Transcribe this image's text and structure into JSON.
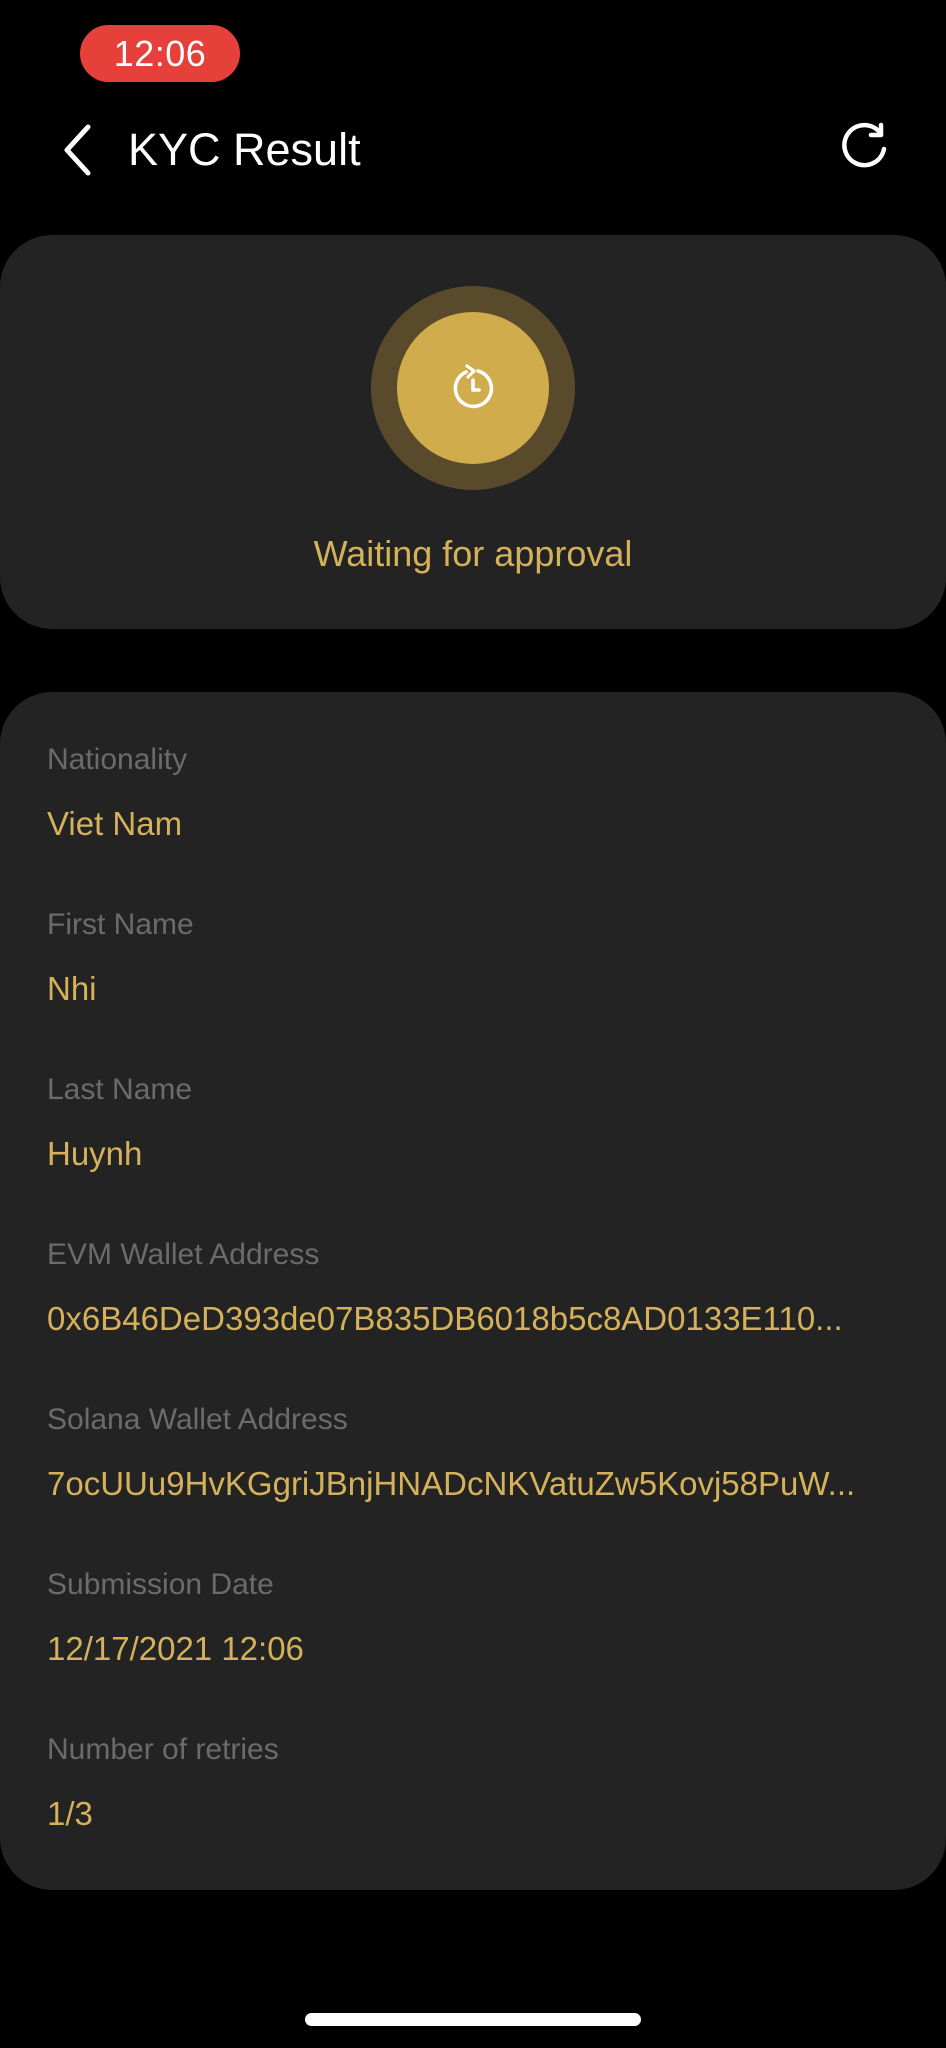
{
  "status_bar": {
    "time": "12:06"
  },
  "header": {
    "title": "KYC Result",
    "back_icon": "chevron-left-icon",
    "refresh_icon": "refresh-icon"
  },
  "status": {
    "icon": "clock-pending-icon",
    "text": "Waiting for approval"
  },
  "fields": [
    {
      "label": "Nationality",
      "value": "Viet Nam"
    },
    {
      "label": "First Name",
      "value": "Nhi"
    },
    {
      "label": "Last Name",
      "value": "Huynh"
    },
    {
      "label": "EVM Wallet Address",
      "value": "0x6B46DeD393de07B835DB6018b5c8AD0133E110..."
    },
    {
      "label": "Solana Wallet Address",
      "value": "7ocUUu9HvKGgriJBnjHNADcNKVatuZw5Kovj58PuW..."
    },
    {
      "label": "Submission Date",
      "value": "12/17/2021 12:06"
    },
    {
      "label": "Number of retries",
      "value": "1/3"
    }
  ],
  "colors": {
    "background": "#000000",
    "card": "#232323",
    "accent": "#d4b15a",
    "label": "#6b6b6b",
    "time_pill": "#e5413a"
  }
}
